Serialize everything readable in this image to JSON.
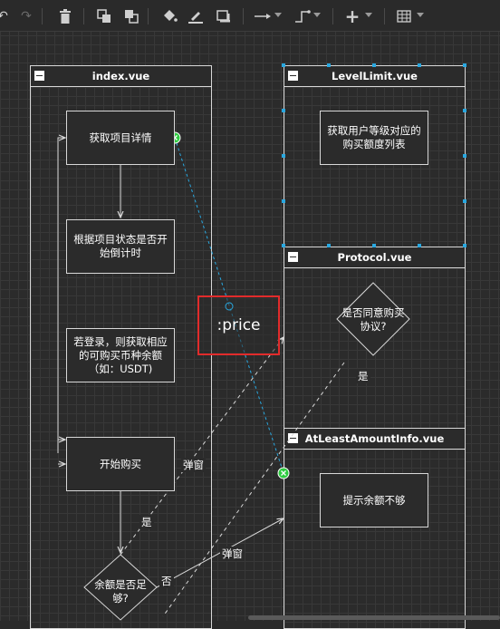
{
  "toolbar": {
    "tools": [
      "undo-icon",
      "redo-icon",
      "delete-icon",
      "to-front-icon",
      "to-back-icon",
      "fill-color-icon",
      "line-color-icon",
      "shadow-icon",
      "connection-icon",
      "waypoints-icon",
      "insert-icon",
      "table-icon"
    ]
  },
  "pools": {
    "index": {
      "title": "index.vue"
    },
    "levellimit": {
      "title": "LevelLimit.vue"
    },
    "protocol": {
      "title": "Protocol.vue"
    },
    "atleast": {
      "title": "AtLeastAmountInfo.vue"
    }
  },
  "nodes": {
    "get_detail": "获取项目详情",
    "countdown": "根据项目状态是否开始倒计时",
    "login_balance": "若登录，则获取相应的可购买币种余额（如：USDT)",
    "start_buy": "开始购买",
    "enough": "余额是否足够?",
    "level_list": "获取用户等级对应的购买额度列表",
    "agree": "是否同意购买协议?",
    "not_enough": "提示余额不够"
  },
  "edge_labels": {
    "popup1": "弹窗",
    "yes1": "是",
    "popup2": "弹窗",
    "no": "否",
    "yes2": "是"
  },
  "annotation": {
    "price": ":price"
  },
  "colors": {
    "background": "#2b2b2b",
    "stroke": "#d8d8d8",
    "dashed_link": "#29a8e0",
    "highlight": "#e12b2b",
    "connector": "#2ecc40"
  }
}
